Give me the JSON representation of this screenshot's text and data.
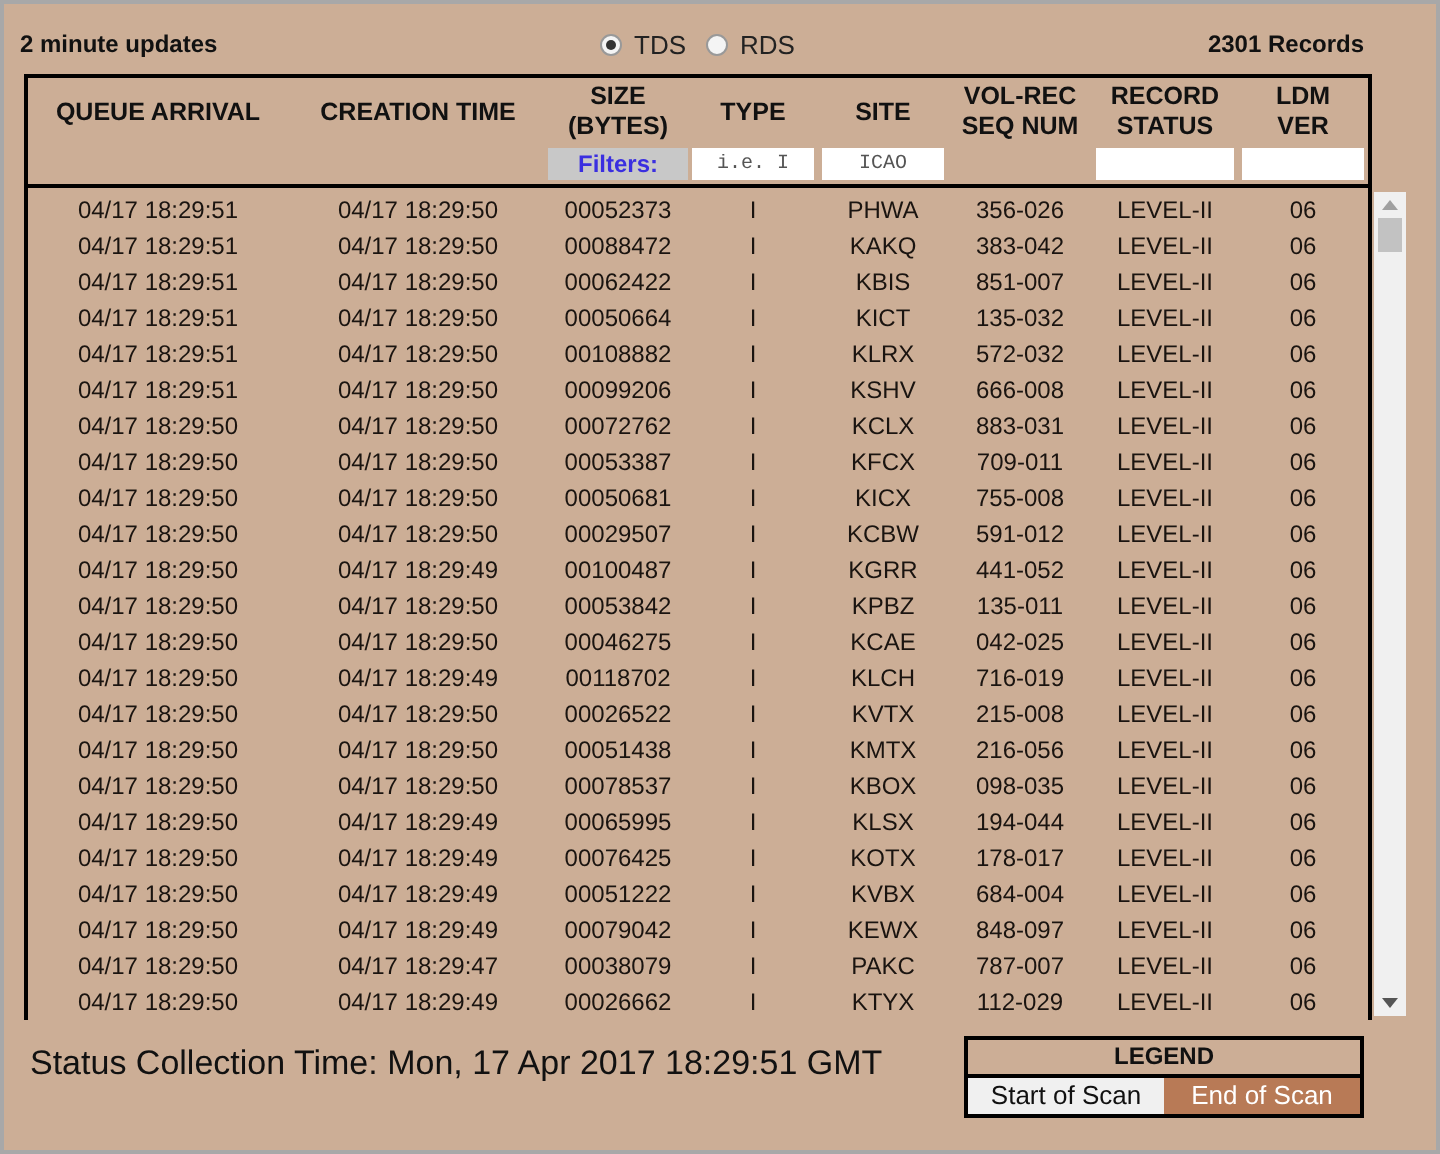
{
  "top_bar": {
    "update_note": "2 minute updates",
    "source_options": [
      {
        "label": "TDS",
        "selected": true
      },
      {
        "label": "RDS",
        "selected": false
      }
    ],
    "record_count": "2301 Records"
  },
  "table": {
    "columns": [
      {
        "label": "QUEUE ARRIVAL"
      },
      {
        "label": "CREATION TIME"
      },
      {
        "label": "SIZE (BYTES)"
      },
      {
        "label": "TYPE"
      },
      {
        "label": "SITE"
      },
      {
        "label": "VOL-REC SEQ NUM"
      },
      {
        "label": "RECORD STATUS"
      },
      {
        "label": "LDM VER"
      }
    ],
    "filter_cells": [
      {
        "kind": "empty"
      },
      {
        "kind": "empty"
      },
      {
        "kind": "label",
        "text": "Filters:"
      },
      {
        "kind": "input",
        "placeholder": "i.e. I"
      },
      {
        "kind": "input",
        "placeholder": "ICAO"
      },
      {
        "kind": "empty"
      },
      {
        "kind": "input"
      },
      {
        "kind": "input"
      }
    ],
    "rows": [
      [
        "04/17 18:29:51",
        "04/17 18:29:50",
        "00052373",
        "I",
        "PHWA",
        "356-026",
        "LEVEL-II",
        "06"
      ],
      [
        "04/17 18:29:51",
        "04/17 18:29:50",
        "00088472",
        "I",
        "KAKQ",
        "383-042",
        "LEVEL-II",
        "06"
      ],
      [
        "04/17 18:29:51",
        "04/17 18:29:50",
        "00062422",
        "I",
        "KBIS",
        "851-007",
        "LEVEL-II",
        "06"
      ],
      [
        "04/17 18:29:51",
        "04/17 18:29:50",
        "00050664",
        "I",
        "KICT",
        "135-032",
        "LEVEL-II",
        "06"
      ],
      [
        "04/17 18:29:51",
        "04/17 18:29:50",
        "00108882",
        "I",
        "KLRX",
        "572-032",
        "LEVEL-II",
        "06"
      ],
      [
        "04/17 18:29:51",
        "04/17 18:29:50",
        "00099206",
        "I",
        "KSHV",
        "666-008",
        "LEVEL-II",
        "06"
      ],
      [
        "04/17 18:29:50",
        "04/17 18:29:50",
        "00072762",
        "I",
        "KCLX",
        "883-031",
        "LEVEL-II",
        "06"
      ],
      [
        "04/17 18:29:50",
        "04/17 18:29:50",
        "00053387",
        "I",
        "KFCX",
        "709-011",
        "LEVEL-II",
        "06"
      ],
      [
        "04/17 18:29:50",
        "04/17 18:29:50",
        "00050681",
        "I",
        "KICX",
        "755-008",
        "LEVEL-II",
        "06"
      ],
      [
        "04/17 18:29:50",
        "04/17 18:29:50",
        "00029507",
        "I",
        "KCBW",
        "591-012",
        "LEVEL-II",
        "06"
      ],
      [
        "04/17 18:29:50",
        "04/17 18:29:49",
        "00100487",
        "I",
        "KGRR",
        "441-052",
        "LEVEL-II",
        "06"
      ],
      [
        "04/17 18:29:50",
        "04/17 18:29:50",
        "00053842",
        "I",
        "KPBZ",
        "135-011",
        "LEVEL-II",
        "06"
      ],
      [
        "04/17 18:29:50",
        "04/17 18:29:50",
        "00046275",
        "I",
        "KCAE",
        "042-025",
        "LEVEL-II",
        "06"
      ],
      [
        "04/17 18:29:50",
        "04/17 18:29:49",
        "00118702",
        "I",
        "KLCH",
        "716-019",
        "LEVEL-II",
        "06"
      ],
      [
        "04/17 18:29:50",
        "04/17 18:29:50",
        "00026522",
        "I",
        "KVTX",
        "215-008",
        "LEVEL-II",
        "06"
      ],
      [
        "04/17 18:29:50",
        "04/17 18:29:50",
        "00051438",
        "I",
        "KMTX",
        "216-056",
        "LEVEL-II",
        "06"
      ],
      [
        "04/17 18:29:50",
        "04/17 18:29:50",
        "00078537",
        "I",
        "KBOX",
        "098-035",
        "LEVEL-II",
        "06"
      ],
      [
        "04/17 18:29:50",
        "04/17 18:29:49",
        "00065995",
        "I",
        "KLSX",
        "194-044",
        "LEVEL-II",
        "06"
      ],
      [
        "04/17 18:29:50",
        "04/17 18:29:49",
        "00076425",
        "I",
        "KOTX",
        "178-017",
        "LEVEL-II",
        "06"
      ],
      [
        "04/17 18:29:50",
        "04/17 18:29:49",
        "00051222",
        "I",
        "KVBX",
        "684-004",
        "LEVEL-II",
        "06"
      ],
      [
        "04/17 18:29:50",
        "04/17 18:29:49",
        "00079042",
        "I",
        "KEWX",
        "848-097",
        "LEVEL-II",
        "06"
      ],
      [
        "04/17 18:29:50",
        "04/17 18:29:47",
        "00038079",
        "I",
        "PAKC",
        "787-007",
        "LEVEL-II",
        "06"
      ],
      [
        "04/17 18:29:50",
        "04/17 18:29:49",
        "00026662",
        "I",
        "KTYX",
        "112-029",
        "LEVEL-II",
        "06"
      ]
    ]
  },
  "status_collection_time": "Status Collection Time: Mon, 17 Apr 2017 18:29:51 GMT",
  "legend": {
    "title": "LEGEND",
    "items": [
      {
        "label": "Start of Scan",
        "color": "#f0f0f0"
      },
      {
        "label": "End of Scan",
        "color": "#b87a56"
      }
    ]
  }
}
